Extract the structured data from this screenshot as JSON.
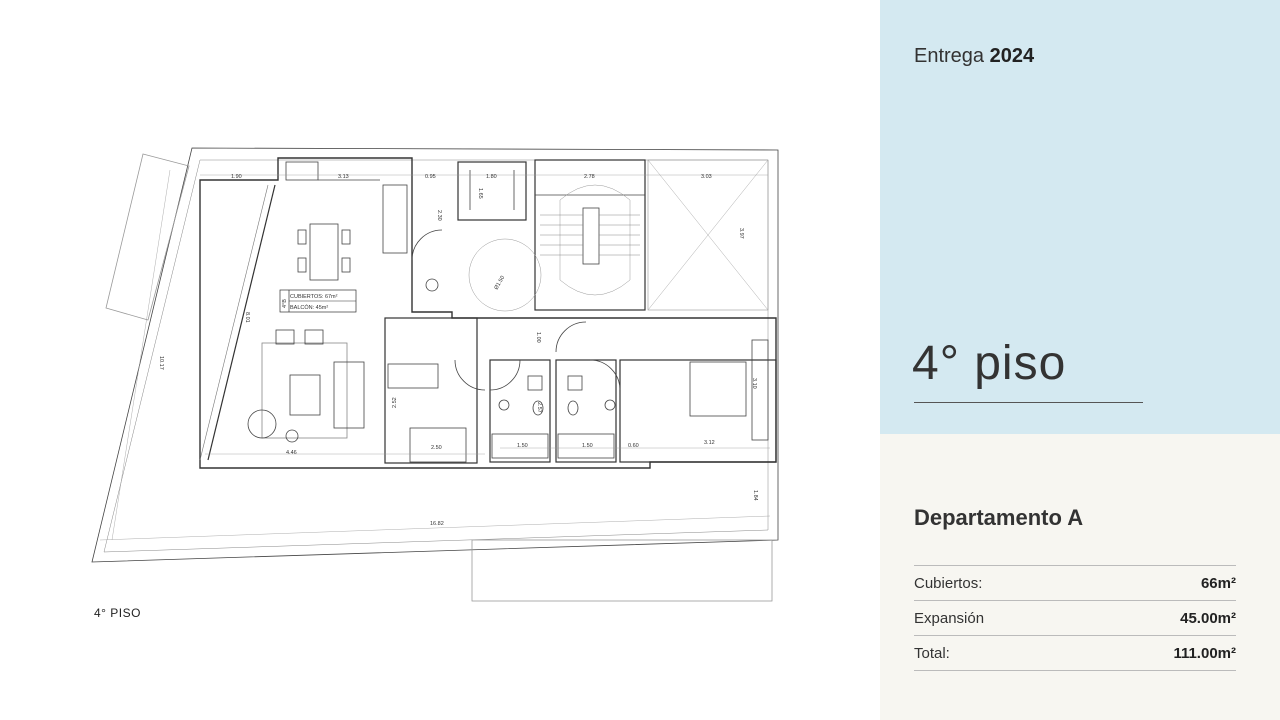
{
  "plan": {
    "caption": "4° PISO",
    "area_box": {
      "line1": "CUBIERTOS: 67m²",
      "line2": "BALCÓN: 45m²",
      "unit": "4°B"
    },
    "dimensions": {
      "d1": "1.90",
      "d2": "3.13",
      "d3": "0.95",
      "d4": "1.80",
      "d5": "2.78",
      "d6": "3.03",
      "d7": "2.30",
      "d8": "1.65",
      "d9": "3.97",
      "d10": "Ø1.50",
      "d11": "8.01",
      "d12": "10.17",
      "d13": "1.00",
      "d14": "2.52",
      "d15": "2.50",
      "d16": "1.50",
      "d17": "1.50",
      "d18": "0.60",
      "d19": "3.12",
      "d20": "3.10",
      "d21": "2.57",
      "d22": "4.46",
      "d23": "16.82",
      "d24": "1.84"
    }
  },
  "header": {
    "delivery_label": "Entrega",
    "delivery_year": "2024"
  },
  "floor": {
    "title": "4° piso"
  },
  "apartment": {
    "title": "Departamento A",
    "rows": [
      {
        "label": "Cubiertos:",
        "value": "66m²"
      },
      {
        "label": "Expansión",
        "value": "45.00m²"
      },
      {
        "label": "Total:",
        "value": "111.00m²"
      }
    ]
  },
  "colors": {
    "side_top_bg": "#d4e9f1",
    "side_bottom_bg": "#f7f6f1",
    "line": "#333333"
  }
}
